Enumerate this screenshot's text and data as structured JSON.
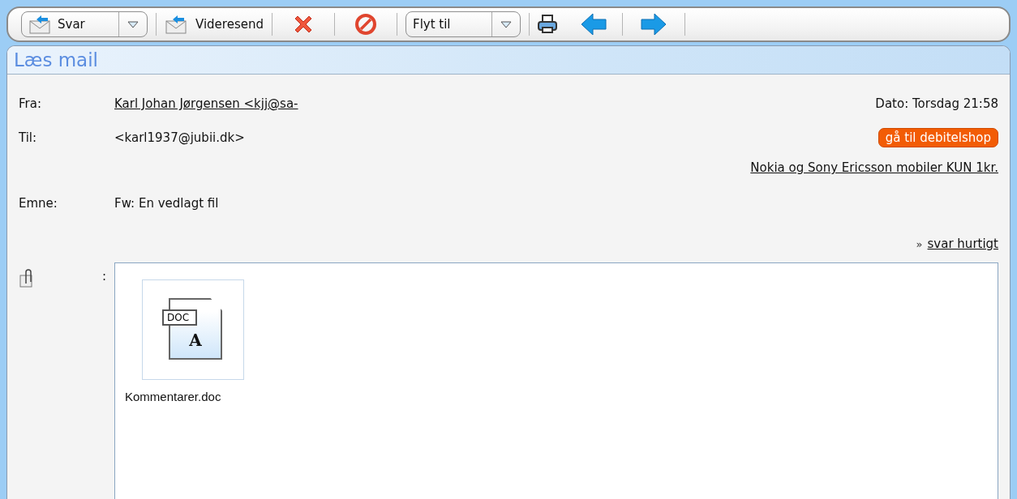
{
  "toolbar": {
    "reply": {
      "label": "Svar"
    },
    "forward": {
      "label": "Videresend"
    },
    "move": {
      "label": "Flyt til"
    }
  },
  "panel": {
    "title": "Læs mail"
  },
  "header": {
    "from_label": "Fra:",
    "from_value": "Karl Johan Jørgensen <kjj@sa-",
    "date": "Dato: Torsdag 21:58",
    "to_label": "Til:",
    "to_value": "<karl1937@jubii.dk>",
    "ad_button": "gå til debitelshop",
    "ad_link": "Nokia og Sony Ericsson mobiler KUN 1kr.",
    "subject_label": "Emne:",
    "subject_value": "Fw: En vedlagt fil",
    "quick_reply_marker": "»",
    "quick_reply": "svar hurtigt"
  },
  "attachments": {
    "separator": ":",
    "files": [
      {
        "name": "Kommentarer.doc",
        "icon_tag": "DOC",
        "icon_letter": "A"
      }
    ]
  }
}
